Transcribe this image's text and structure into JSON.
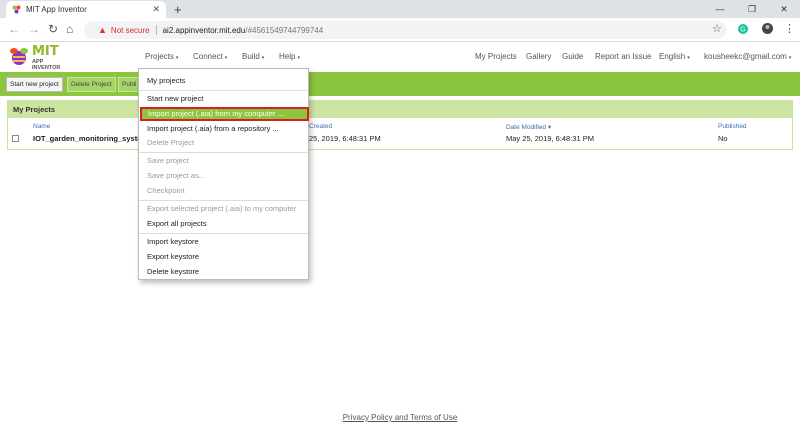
{
  "browser": {
    "tab_title": "MIT App Inventor",
    "new_tab": "+",
    "security_label": "Not secure",
    "url_host": "ai2.appinventor.mit.edu",
    "url_rest": "/#4561549744799744"
  },
  "header": {
    "logo_main": "MIT",
    "logo_sub": "APP INVENTOR",
    "menus": [
      "Projects",
      "Connect",
      "Build",
      "Help"
    ],
    "links": [
      "My Projects",
      "Gallery",
      "Guide",
      "Report an Issue",
      "English",
      "kousheekc@gmail.com"
    ]
  },
  "toolbar": {
    "buttons": [
      "Start new project",
      "Delete Project",
      "Publi"
    ]
  },
  "projects": {
    "panel_title": "My Projects",
    "columns": {
      "name": "Name",
      "created": "Created",
      "modified": "Date Modified ▾",
      "published": "Published"
    },
    "rows": [
      {
        "name": "IOT_garden_monitoring_system",
        "created": "25, 2019, 6:48:31 PM",
        "modified": "May 25, 2019, 6:48:31 PM",
        "published": "No"
      }
    ]
  },
  "menu": {
    "items": [
      "My projects",
      "Start new project",
      "Import project (.aia) from my computer ...",
      "Import project (.aia) from a repository ...",
      "Delete Project",
      "Save project",
      "Save project as...",
      "Checkpoint",
      "Export selected project (.aia) to my computer",
      "Export all projects",
      "Import keystore",
      "Export keystore",
      "Delete keystore"
    ]
  },
  "footer": {
    "link": "Privacy Policy and Terms of Use"
  },
  "colors": {
    "accent": "#8cc63f",
    "highlight_border": "#d81e1e"
  }
}
